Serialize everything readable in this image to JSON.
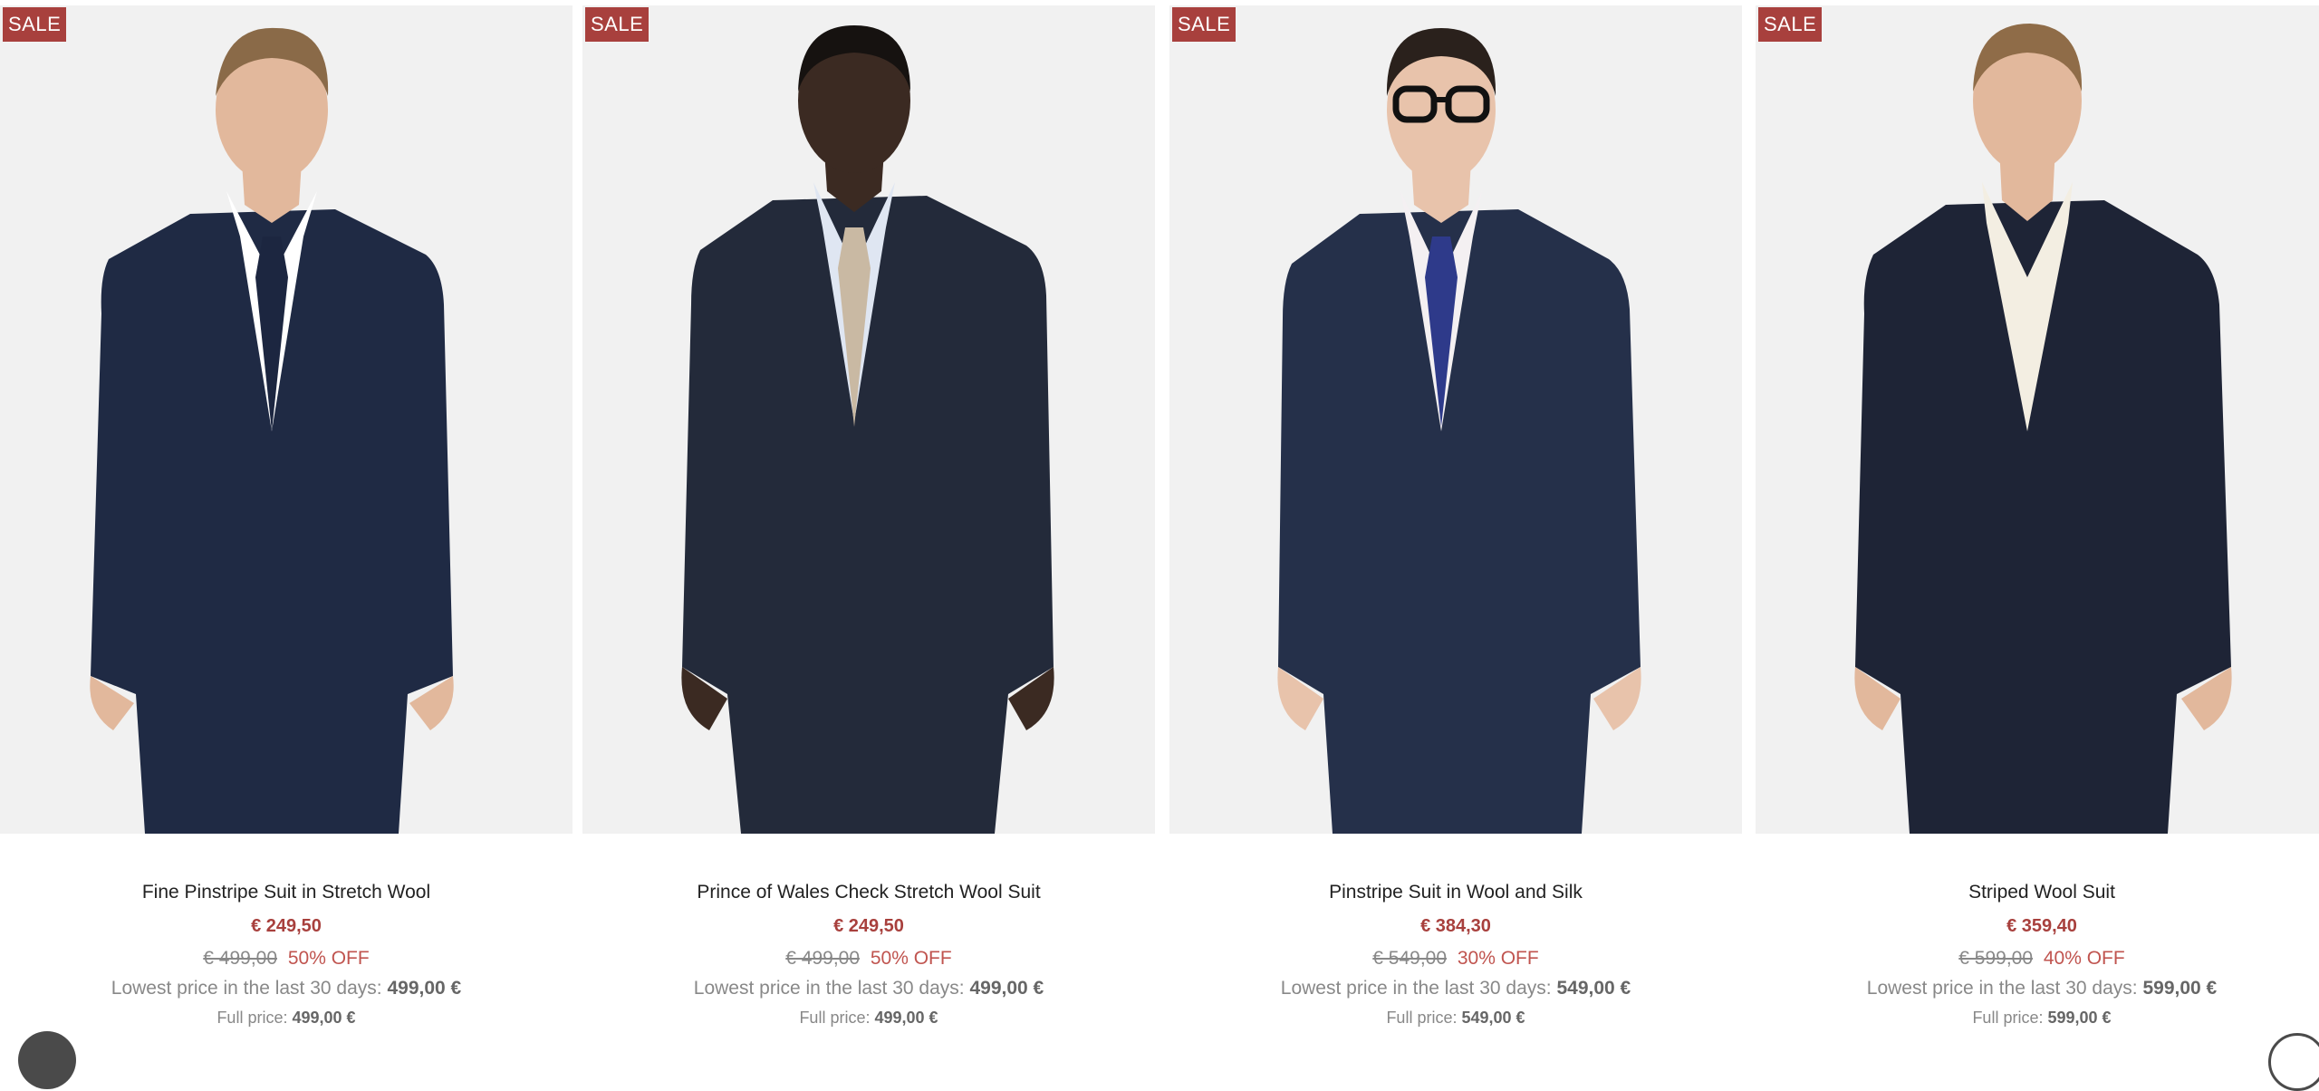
{
  "products": [
    {
      "badge": "SALE",
      "name": "Fine Pinstripe Suit in Stretch Wool",
      "price": "€ 249,50",
      "original_price": "€ 499,00",
      "discount": "50% OFF",
      "lowest_label": "Lowest price in the last 30 days:",
      "lowest_value": "499,00 €",
      "full_label": "Full price:",
      "full_value": "499,00 €",
      "colors": {
        "suit": "#1f2a44",
        "tie": "#1c2640",
        "shirt": "#ffffff",
        "hair": "#8a6a48",
        "skin": "#e2b89c"
      }
    },
    {
      "badge": "SALE",
      "name": "Prince of Wales Check Stretch Wool Suit",
      "price": "€ 249,50",
      "original_price": "€ 499,00",
      "discount": "50% OFF",
      "lowest_label": "Lowest price in the last 30 days:",
      "lowest_value": "499,00 €",
      "full_label": "Full price:",
      "full_value": "499,00 €",
      "colors": {
        "suit": "#232a3a",
        "tie": "#c9b9a3",
        "shirt": "#dfe6f2",
        "hair": "#161210",
        "skin": "#3b2a22"
      }
    },
    {
      "badge": "SALE",
      "name": "Pinstripe Suit in Wool and Silk",
      "price": "€ 384,30",
      "original_price": "€ 549,00",
      "discount": "30% OFF",
      "lowest_label": "Lowest price in the last 30 days:",
      "lowest_value": "549,00 €",
      "full_label": "Full price:",
      "full_value": "549,00 €",
      "colors": {
        "suit": "#25304a",
        "tie": "#2e3a8a",
        "shirt": "#f4f0f2",
        "hair": "#2a211c",
        "skin": "#e8c3ab"
      }
    },
    {
      "badge": "SALE",
      "name": "Striped Wool Suit",
      "price": "€ 359,40",
      "original_price": "€ 599,00",
      "discount": "40% OFF",
      "lowest_label": "Lowest price in the last 30 days:",
      "lowest_value": "599,00 €",
      "full_label": "Full price:",
      "full_value": "599,00 €",
      "colors": {
        "suit": "#1e2436",
        "tie": "#f3eee2",
        "shirt": "#f3eee2",
        "hair": "#8f6c48",
        "skin": "#e2b89c"
      }
    }
  ],
  "ui": {
    "accent": "#a8403d",
    "photo_bg": "#f1f1f1"
  }
}
